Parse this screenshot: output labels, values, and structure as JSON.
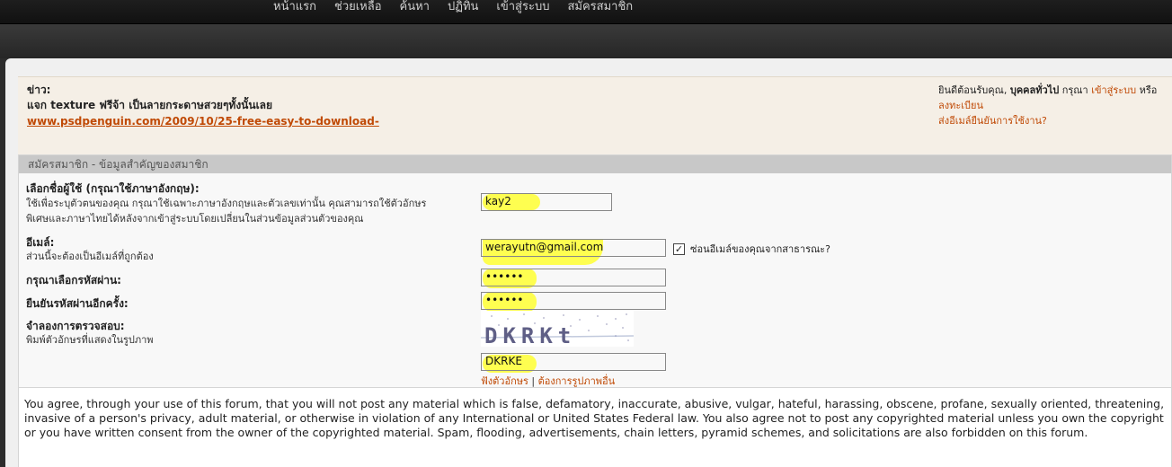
{
  "nav": {
    "items": [
      "หน้าแรก",
      "ช่วยเหลือ",
      "ค้นหา",
      "ปฏิทิน",
      "เข้าสู่ระบบ",
      "สมัครสมาชิก"
    ]
  },
  "news": {
    "label": "ข่าว:",
    "text": "แจก texture ฟรีจ้า เป็นลายกระดาษสวยๆทั้งนั้นเลย",
    "link": "www.psdpenguin.com/2009/10/25-free-easy-to-download-"
  },
  "welcome": {
    "greet_prefix": "ยินดีต้อนรับคุณ,",
    "guest": "บุคคลทั่วไป",
    "please": "กรุณา",
    "login": "เข้าสู่ระบบ",
    "or": "หรือ",
    "register": "ลงทะเบียน",
    "resend": "ส่งอีเมล์ยืนยันการใช้งาน?"
  },
  "registration": {
    "header": "สมัครสมาชิก - ข้อมูลสำคัญของสมาชิก",
    "username": {
      "label": "เลือกชื่อผู้ใช้ (กรุณาใช้ภาษาอังกฤษ):",
      "desc1": "ใช้เพื่อระบุตัวตนของคุณ กรุณาใช้เฉพาะภาษาอังกฤษและตัวเลขเท่านั้น คุณสามารถใช้ตัวอักษร",
      "desc2": "พิเศษและภาษาไทยได้หลังจากเข้าสู่ระบบโดยเปลี่ยนในส่วนข้อมูลส่วนตัวของคุณ",
      "value": "kay2"
    },
    "email": {
      "label": "อีเมล์:",
      "desc": "ส่วนนี้จะต้องเป็นอีเมล์ที่ถูกต้อง",
      "value": "werayutn@gmail.com",
      "hide_label": "ซ่อนอีเมล์ของคุณจากสาธารณะ?",
      "hide_checked": "✓"
    },
    "password": {
      "label": "กรุณาเลือกรหัสผ่าน:",
      "value": "••••••"
    },
    "password_confirm": {
      "label": "ยืนยันรหัสผ่านอีกครั้ง:",
      "value": "••••••"
    },
    "captcha": {
      "label": "จำลองการตรวจสอบ:",
      "desc": "พิมพ์ตัวอักษรที่แสดงในรูปภาพ",
      "image_text": "DKRKt",
      "value": "DKRKE",
      "listen": "ฟังตัวอักษร",
      "separator": "|",
      "other_image": "ต้องการรูปภาพอื่น"
    }
  },
  "terms": {
    "text": "You agree, through your use of this forum, that you will not post any material which is false, defamatory, inaccurate, abusive, vulgar, hateful, harassing, obscene, profane, sexually oriented, threatening, invasive of a person's privacy, adult material, or otherwise in violation of any International or United States Federal law. You also agree not to post any copyrighted material unless you own the copyright or you have written consent from the owner of the copyrighted material. Spam, flooding, advertisements, chain letters, pyramid schemes, and solicitations are also forbidden on this forum."
  },
  "colors": {
    "link": "#c04a06",
    "highlight": "#ffff33"
  }
}
